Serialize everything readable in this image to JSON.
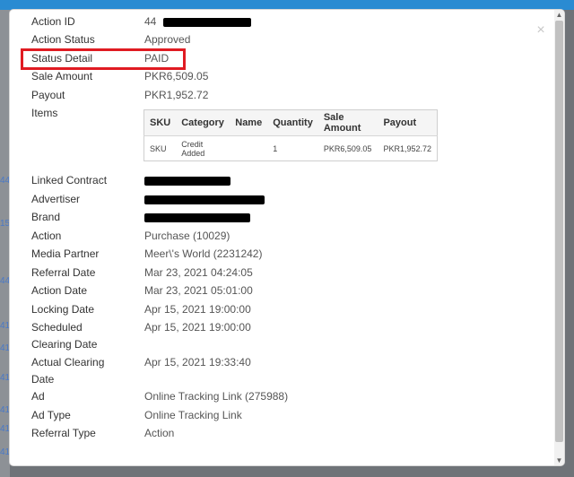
{
  "background_numbers": [
    "44",
    "15",
    "44",
    "41",
    "41",
    "41",
    "41",
    "41",
    "41"
  ],
  "modal": {
    "fields": [
      {
        "label": "Action ID",
        "value": "44",
        "redacted": true
      },
      {
        "label": "Action Status",
        "value": "Approved"
      },
      {
        "label": "Status Detail",
        "value": "PAID",
        "highlighted": true
      },
      {
        "label": "Sale Amount",
        "value": "PKR6,509.05"
      },
      {
        "label": "Payout",
        "value": "PKR1,952.72"
      },
      {
        "label": "Items"
      },
      {
        "label": "Linked Contract",
        "redacted": true
      },
      {
        "label": "Advertiser",
        "redacted": true
      },
      {
        "label": "Brand",
        "redacted": true
      },
      {
        "label": "Action",
        "value": "Purchase (10029)"
      },
      {
        "label": "Media Partner",
        "value": "Meer\\'s World (2231242)"
      },
      {
        "label": "Referral Date",
        "value": "Mar 23, 2021 04:24:05"
      },
      {
        "label": "Action Date",
        "value": "Mar 23, 2021 05:01:00"
      },
      {
        "label": "Locking Date",
        "value": "Apr 15, 2021 19:00:00"
      },
      {
        "label": "Scheduled Clearing Date",
        "label_line1": "Scheduled",
        "label_line2": "Clearing Date",
        "value": "Apr 15, 2021 19:00:00"
      },
      {
        "label": "Actual Clearing Date",
        "label_line1": "Actual Clearing",
        "label_line2": "Date",
        "value": "Apr 15, 2021 19:33:40"
      },
      {
        "label": "Ad",
        "value": "Online Tracking Link (275988)"
      },
      {
        "label": "Ad Type",
        "value": "Online Tracking Link"
      },
      {
        "label": "Referral Type",
        "value": "Action"
      }
    ],
    "items_table": {
      "headers": [
        "SKU",
        "Category",
        "Name",
        "Quantity",
        "Sale Amount",
        "Payout"
      ],
      "rows": [
        [
          "SKU",
          "Credit Added",
          "",
          "1",
          "PKR6,509.05",
          "PKR1,952.72"
        ]
      ]
    },
    "close_icon": "×"
  },
  "colors": {
    "highlight_border": "#e01b22",
    "top_bar": "#2a8bd2"
  }
}
